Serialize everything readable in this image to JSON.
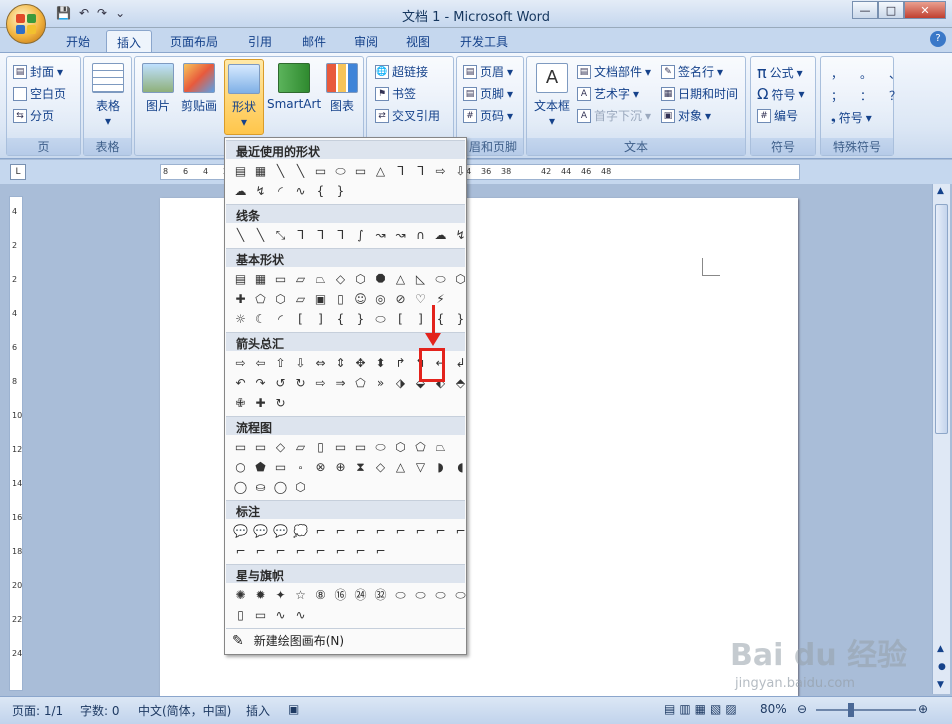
{
  "window": {
    "title": "文档 1 - Microsoft Word"
  },
  "qat": {
    "save": "💾",
    "undo": "↶",
    "redo": "↷",
    "more": "⌄"
  },
  "tabs": [
    "开始",
    "插入",
    "页面布局",
    "引用",
    "邮件",
    "审阅",
    "视图",
    "开发工具"
  ],
  "active_tab": "插入",
  "ribbon": {
    "page_group": {
      "label": "页",
      "cover": "封面",
      "blank": "空白页",
      "break": "分页"
    },
    "table_group": {
      "label": "表格",
      "table": "表格"
    },
    "illustrations": {
      "picture": "图片",
      "clipart": "剪贴画",
      "shapes": "形状",
      "smartart": "SmartArt",
      "chart": "图表"
    },
    "links": {
      "hyperlink": "超链接",
      "bookmark": "书签",
      "crossref": "交叉引用"
    },
    "header_footer": {
      "label": "眉和页脚",
      "header": "页眉",
      "footer": "页脚",
      "pagenum": "页码"
    },
    "text_group": {
      "label": "文本",
      "textbox": "文本框",
      "parts": "文档部件",
      "wordart": "艺术字",
      "dropcap": "首字下沉",
      "signature": "签名行",
      "datetime": "日期和时间",
      "object": "对象"
    },
    "symbols": {
      "label": "符号",
      "formula": "公式",
      "symbol": "符号",
      "number": "编号"
    },
    "special": {
      "label": "特殊符号",
      "symbol": "符号",
      "chars": [
        "，",
        "。",
        "、",
        "；",
        "：",
        "？"
      ]
    }
  },
  "ruler": {
    "h_ticks": [
      "8",
      "6",
      "4",
      "2",
      "20",
      "22",
      "24",
      "26",
      "28",
      "30",
      "32",
      "34",
      "36",
      "38",
      "42",
      "44",
      "46",
      "48"
    ],
    "v_ticks": [
      "4",
      "2",
      "2",
      "4",
      "6",
      "8",
      "10",
      "12",
      "14",
      "16",
      "18",
      "20",
      "22",
      "24"
    ]
  },
  "dropdown": {
    "cats": [
      "最近使用的形状",
      "线条",
      "基本形状",
      "箭头总汇",
      "流程图",
      "标注",
      "星与旗帜"
    ],
    "recent": [
      "▤",
      "▦",
      "╲",
      "╲",
      "▭",
      "⬭",
      "▭",
      "△",
      "ᒣ",
      "ᒣ",
      "⇨",
      "⇩"
    ],
    "recent2": [
      "☁",
      "↯",
      "◜",
      "∿",
      "{",
      "}"
    ],
    "lines": [
      "╲",
      "╲",
      "⤡",
      "ᒣ",
      "ᒣ",
      "ᒣ",
      "∫",
      "↝",
      "↝",
      "∩",
      "☁",
      "↯"
    ],
    "basic1": [
      "▤",
      "▦",
      "▭",
      "▱",
      "⏢",
      "◇",
      "⬡",
      "⯃",
      "△",
      "◺",
      "⬭",
      "⬡"
    ],
    "basic2": [
      "✚",
      "⬠",
      "⬡",
      "▱",
      "▣",
      "▯",
      "☺",
      "◎",
      "⊘",
      "♡",
      "⚡"
    ],
    "basic3": [
      "☼",
      "☾",
      "◜",
      "[",
      "]",
      "{",
      "}",
      "⬭",
      "[",
      "]",
      "{",
      "}"
    ],
    "arrows1": [
      "⇨",
      "⇦",
      "⇧",
      "⇩",
      "⇔",
      "⇕",
      "✥",
      "⬍",
      "↱",
      "↰",
      "↵",
      "↲"
    ],
    "arrows2": [
      "↶",
      "↷",
      "↺",
      "↻",
      "⇨",
      "⇒",
      "⬠",
      "»",
      "⬗",
      "⬙",
      "⬖",
      "⬘"
    ],
    "arrows3": [
      "✙",
      "✚",
      "↻"
    ],
    "flow1": [
      "▭",
      "▭",
      "◇",
      "▱",
      "▯",
      "▭",
      "▭",
      "⬭",
      "⬡",
      "⬠",
      "⏢"
    ],
    "flow2": [
      "○",
      "⬟",
      "▭",
      "⬞",
      "⊗",
      "⊕",
      "⧗",
      "◇",
      "△",
      "▽",
      "◗",
      "◖"
    ],
    "flow3": [
      "◯",
      "⛀",
      "◯",
      "⬡"
    ],
    "callouts1": [
      "💬",
      "💬",
      "💬",
      "💭",
      "⌐",
      "⌐",
      "⌐",
      "⌐",
      "⌐",
      "⌐",
      "⌐",
      "⌐"
    ],
    "callouts2": [
      "⌐",
      "⌐",
      "⌐",
      "⌐",
      "⌐",
      "⌐",
      "⌐",
      "⌐"
    ],
    "stars1": [
      "✺",
      "✹",
      "✦",
      "☆",
      "⑧",
      "⑯",
      "㉔",
      "㉜",
      "⬭",
      "⬭",
      "⬭",
      "⬭"
    ],
    "stars2": [
      "▯",
      "▭",
      "∿",
      "∿"
    ],
    "new_canvas": "新建绘图画布(N)"
  },
  "status": {
    "page": "页面: 1/1",
    "words": "字数: 0",
    "lang": "中文(简体，中国)",
    "mode": "插入",
    "zoom": "80%"
  },
  "watermark": {
    "text": "Bai du 经验",
    "url": "jingyan.baidu.com"
  }
}
